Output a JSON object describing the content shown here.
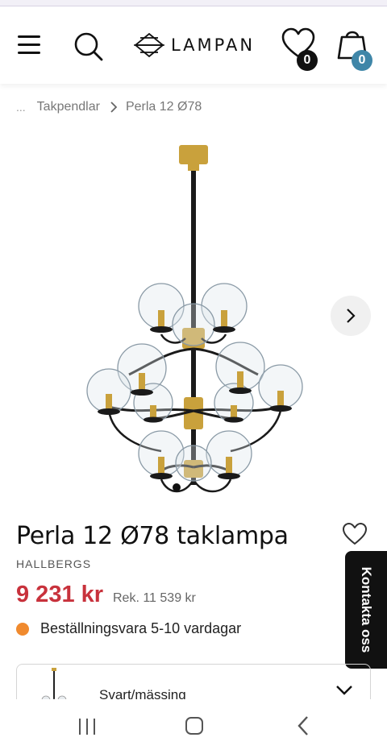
{
  "header": {
    "logo_text": "LAMPAN",
    "wishlist_count": "0",
    "cart_count": "0"
  },
  "breadcrumb": {
    "ellipsis": "...",
    "items": [
      {
        "label": "Takpendlar"
      },
      {
        "label": "Perla 12 Ø78"
      }
    ]
  },
  "product": {
    "title": "Perla 12 Ø78 taklampa",
    "brand": "HALLBERGS",
    "price": "9 231 kr",
    "rrp": "Rek. 11 539 kr",
    "stock_text": "Beställningsvara 5-10 vardagar",
    "stock_color": "#f08a2e",
    "price_color": "#c8323c",
    "variant_label": "Svart/mässing"
  },
  "contact": {
    "label": "Kontakta oss"
  },
  "icons": {
    "menu": "hamburger-icon",
    "search": "search-icon",
    "wishlist": "heart-icon",
    "cart": "shopping-bag-icon",
    "next": "chevron-right-icon",
    "favorite": "heart-outline-icon",
    "dropdown": "chevron-down-icon"
  },
  "colors": {
    "cart_badge": "#3f86a8",
    "wish_badge": "#111111",
    "brass": "#c9a13c"
  }
}
